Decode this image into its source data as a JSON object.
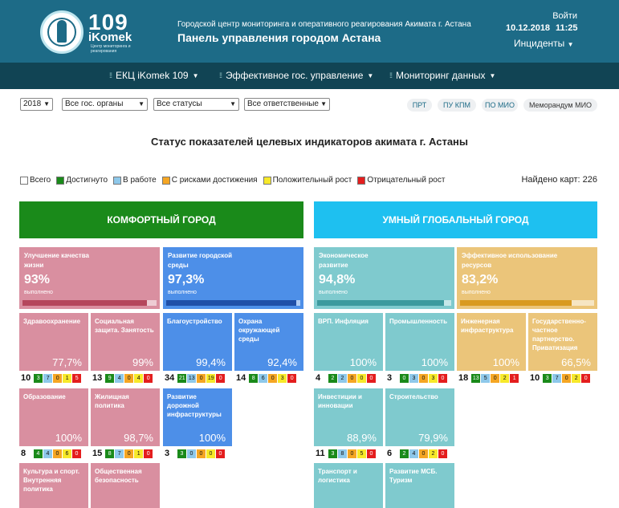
{
  "header": {
    "logo_number": "109",
    "logo_name": "iKomek",
    "logo_sub": "Центр мониторинга и реагирования",
    "line1": "Городской центр мониторинга и оперативного реагирования Акимата г. Астана",
    "line2": "Панель управления городом Астана",
    "login": "Войти",
    "date": "10.12.2018",
    "time": "11:25",
    "incidents": "Инциденты"
  },
  "nav": {
    "items": [
      {
        "label": "ЕКЦ iKomek 109"
      },
      {
        "label": "Эффективное гос. управление"
      },
      {
        "label": "Мониторинг данных"
      }
    ]
  },
  "filters": {
    "year": "2018",
    "organs": "Все гос. органы",
    "statuses": "Все статусы",
    "responsible": "Все ответственные",
    "pills": [
      "ПРТ",
      "ПУ КПМ",
      "ПО МИО",
      "Меморандум МИО"
    ]
  },
  "page_title": "Статус показателей целевых индикаторов акимата г. Астаны",
  "legend": {
    "items": [
      "Всего",
      "Достигнуто",
      "В работе",
      "С рисками достижения",
      "Положительный рост",
      "Отрицательный рост"
    ],
    "colors": [
      "#ffffff",
      "#1a8a1a",
      "#8ec8ea",
      "#f5a623",
      "#f7e92a",
      "#e41e1e"
    ]
  },
  "found": "Найдено карт: 226",
  "sections": {
    "comfort": {
      "title": "КОМФОРТНЫЙ ГОРОД",
      "color": "#1a8a1a"
    },
    "smart": {
      "title": "УМНЫЙ ГЛОБАЛЬНЫЙ ГОРОД",
      "color": "#1ec0f0"
    }
  },
  "big_cards": [
    {
      "title": "Улучшение качества жизни",
      "pct": "93%",
      "done": "выполнено",
      "fill": 0.93
    },
    {
      "title": "Развитие городской среды",
      "pct": "97,3%",
      "done": "выполнено",
      "fill": 0.973
    },
    {
      "title": "Экономическое развитие",
      "pct": "94,8%",
      "done": "выполнено",
      "fill": 0.948
    },
    {
      "title": "Эффективное использование ресурсов",
      "pct": "83,2%",
      "done": "выполнено",
      "fill": 0.832
    }
  ],
  "tiles": [
    {
      "title": "Здравоохранение",
      "pct": "77,7%",
      "total": "10",
      "c": [
        "3",
        "7",
        "0",
        "1",
        "5"
      ]
    },
    {
      "title": "Социальная защита. Занятость",
      "pct": "99%",
      "total": "13",
      "c": [
        "9",
        "4",
        "0",
        "4",
        "0"
      ]
    },
    {
      "title": "Благоустройство",
      "pct": "99,4%",
      "total": "34",
      "c": [
        "21",
        "13",
        "0",
        "19",
        "0"
      ]
    },
    {
      "title": "Охрана окружающей среды",
      "pct": "92,4%",
      "total": "14",
      "c": [
        "8",
        "6",
        "0",
        "3",
        "0"
      ]
    },
    {
      "title": "ВРП. Инфляция",
      "pct": "100%",
      "total": "4",
      "c": [
        "2",
        "2",
        "0",
        "0",
        "0"
      ]
    },
    {
      "title": "Промышленность",
      "pct": "100%",
      "total": "3",
      "c": [
        "0",
        "3",
        "0",
        "3",
        "0"
      ]
    },
    {
      "title": "Инженерная инфраструктура",
      "pct": "100%",
      "total": "18",
      "c": [
        "13",
        "5",
        "0",
        "2",
        "1"
      ]
    },
    {
      "title": "Государственно-частное партнерство. Приватизация",
      "pct": "66,5%",
      "total": "10",
      "c": [
        "3",
        "7",
        "0",
        "2",
        "0"
      ]
    },
    {
      "title": "Образование",
      "pct": "100%",
      "total": "8",
      "c": [
        "4",
        "4",
        "0",
        "6",
        "0"
      ]
    },
    {
      "title": "Жилищная политика",
      "pct": "98,7%",
      "total": "15",
      "c": [
        "8",
        "7",
        "0",
        "1",
        "0"
      ]
    },
    {
      "title": "Развитие дорожной инфраструктуры",
      "pct": "100%",
      "total": "3",
      "c": [
        "3",
        "0",
        "0",
        "0",
        "0"
      ]
    },
    {
      "title": "Инвестиции и инновации",
      "pct": "88,9%",
      "total": "11",
      "c": [
        "3",
        "8",
        "0",
        "5",
        "0"
      ]
    },
    {
      "title": "Строительство",
      "pct": "79,9%",
      "total": "6",
      "c": [
        "2",
        "4",
        "0",
        "2",
        "0"
      ]
    },
    {
      "title": "Культура и спорт. Внутренняя политика"
    },
    {
      "title": "Общественная безопасность"
    },
    {
      "title": "Транспорт и логистика"
    },
    {
      "title": "Развитие МСБ. Туризм"
    }
  ]
}
